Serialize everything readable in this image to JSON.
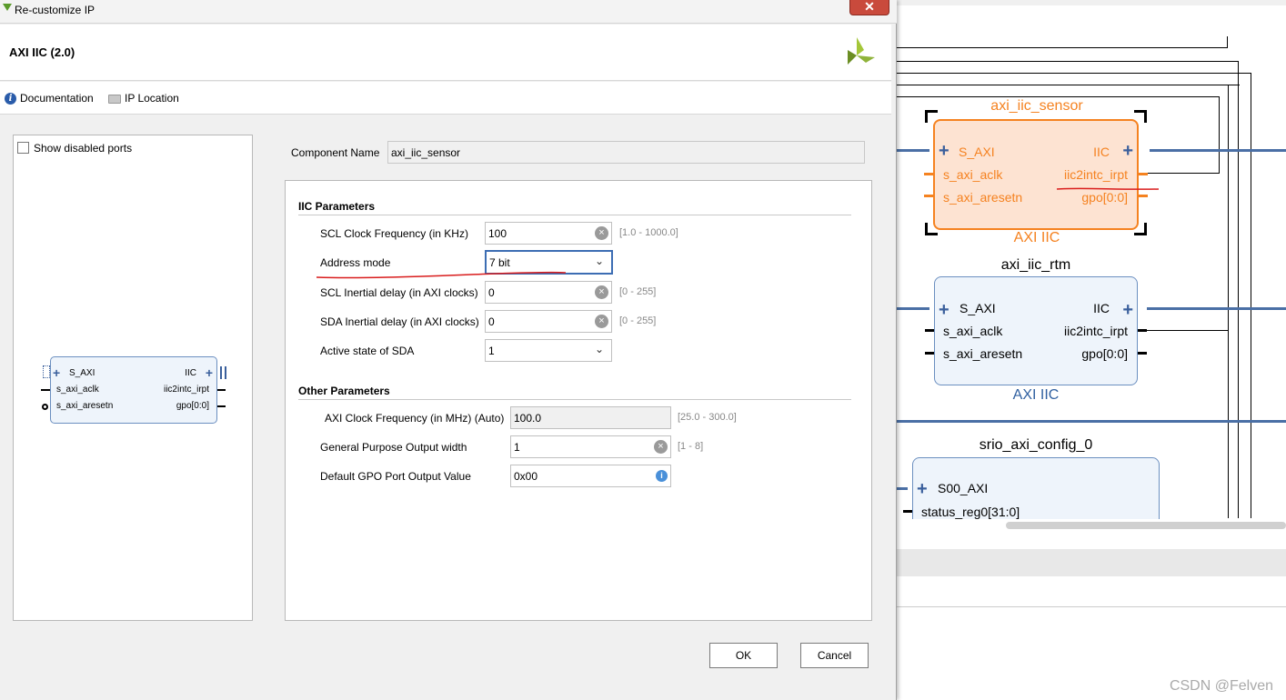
{
  "window": {
    "title": "Re-customize IP"
  },
  "header": {
    "ip_title": "AXI IIC (2.0)"
  },
  "links": {
    "documentation": "Documentation",
    "ip_location": "IP Location"
  },
  "left_panel": {
    "show_disabled_ports": "Show disabled ports",
    "symbol": {
      "left_ports": [
        "S_AXI",
        "s_axi_aclk",
        "s_axi_aresetn"
      ],
      "right_ports": [
        "IIC",
        "iic2intc_irpt",
        "gpo[0:0]"
      ]
    }
  },
  "component": {
    "label": "Component Name",
    "value": "axi_iic_sensor"
  },
  "iic_params": {
    "title": "IIC Parameters",
    "scl_freq": {
      "label": "SCL Clock Frequency (in KHz)",
      "value": "100",
      "range": "[1.0 - 1000.0]"
    },
    "address_mode": {
      "label": "Address mode",
      "value": "7 bit"
    },
    "scl_inertial": {
      "label": "SCL Inertial delay (in AXI clocks)",
      "value": "0",
      "range": "[0 - 255]"
    },
    "sda_inertial": {
      "label": "SDA Inertial delay (in AXI clocks)",
      "value": "0",
      "range": "[0 - 255]"
    },
    "sda_active": {
      "label": "Active state of SDA",
      "value": "1"
    }
  },
  "other_params": {
    "title": "Other Parameters",
    "axi_clk": {
      "label": "AXI Clock Frequency (in MHz) (Auto)",
      "value": "100.0",
      "range": "[25.0 - 300.0]"
    },
    "gpo_width": {
      "label": "General Purpose Output width",
      "value": "1",
      "range": "[1 - 8]"
    },
    "gpo_default": {
      "label": "Default GPO Port Output Value",
      "value": "0x00"
    }
  },
  "buttons": {
    "ok": "OK",
    "cancel": "Cancel"
  },
  "canvas": {
    "block1": {
      "name": "axi_iic_sensor",
      "type": "AXI IIC",
      "left_ports": [
        "S_AXI",
        "s_axi_aclk",
        "s_axi_aresetn"
      ],
      "right_ports": [
        "IIC",
        "iic2intc_irpt",
        "gpo[0:0]"
      ]
    },
    "block2": {
      "name": "axi_iic_rtm",
      "type": "AXI IIC",
      "left_ports": [
        "S_AXI",
        "s_axi_aclk",
        "s_axi_aresetn"
      ],
      "right_ports": [
        "IIC",
        "iic2intc_irpt",
        "gpo[0:0]"
      ]
    },
    "block3": {
      "name": "srio_axi_config_0",
      "left_ports": [
        "S00_AXI",
        "status_reg0[31:0]"
      ]
    }
  },
  "watermark": "CSDN @Felven",
  "colors": {
    "selected_block": "#f58220",
    "selected_fill": "#fde3d2",
    "bus": "#4a6fa5",
    "annotation": "#d91c1c"
  }
}
